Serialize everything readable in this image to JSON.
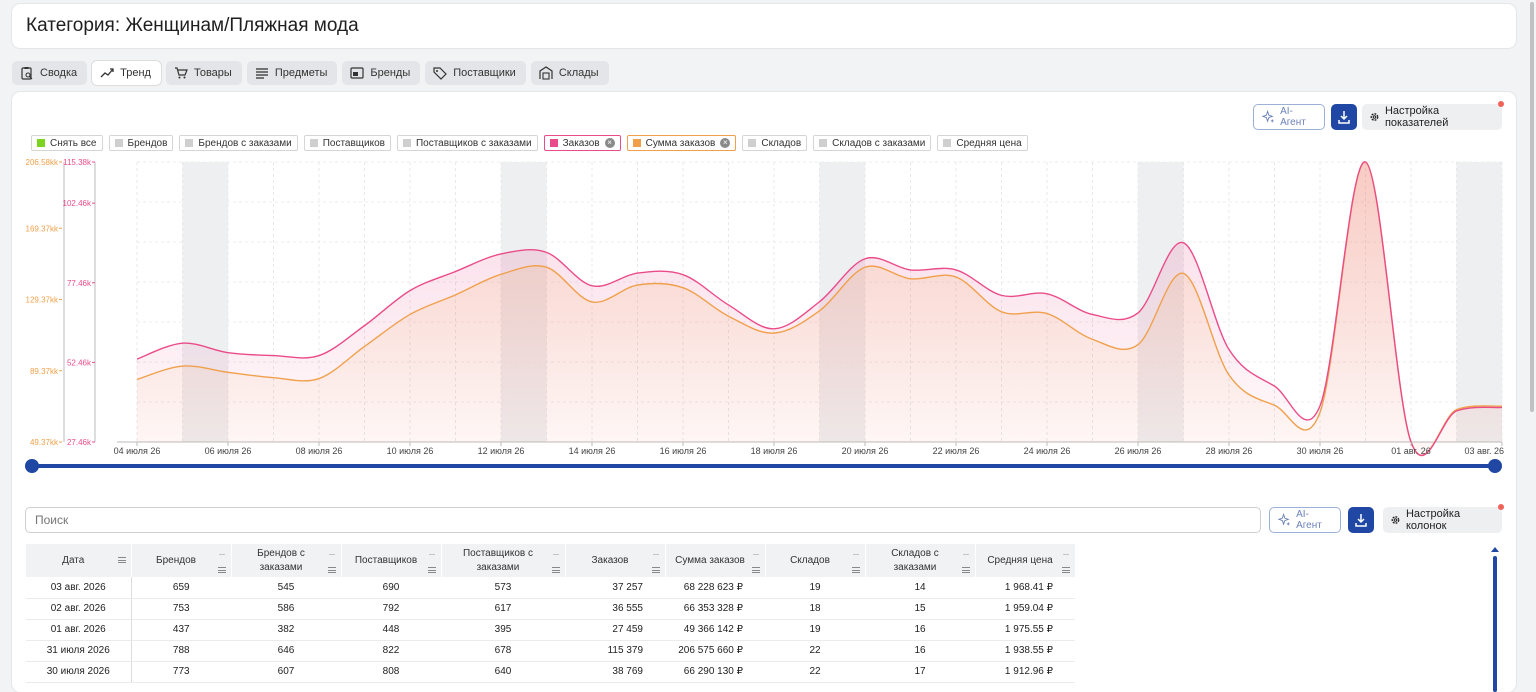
{
  "page_title": "Категория: Женщинам/Пляжная мода",
  "tabs": [
    {
      "label": "Сводка",
      "icon": "clipboard-search-icon",
      "active": false
    },
    {
      "label": "Тренд",
      "icon": "trend-icon",
      "active": true
    },
    {
      "label": "Товары",
      "icon": "cart-icon",
      "active": false
    },
    {
      "label": "Предметы",
      "icon": "list-icon",
      "active": false
    },
    {
      "label": "Бренды",
      "icon": "brand-icon",
      "active": false
    },
    {
      "label": "Поставщики",
      "icon": "tag-icon",
      "active": false
    },
    {
      "label": "Склады",
      "icon": "warehouse-icon",
      "active": false
    }
  ],
  "chart_toolbar": {
    "ai_label": "AI-Агент",
    "settings_label": "Настройка показателей"
  },
  "legend": [
    {
      "label": "Снять все",
      "color": "#7ed321",
      "removable": false
    },
    {
      "label": "Брендов",
      "color": "#cfcfcf",
      "removable": false
    },
    {
      "label": "Брендов с заказами",
      "color": "#cfcfcf",
      "removable": false
    },
    {
      "label": "Поставщиков",
      "color": "#cfcfcf",
      "removable": false
    },
    {
      "label": "Поставщиков с заказами",
      "color": "#cfcfcf",
      "removable": false
    },
    {
      "label": "Заказов",
      "color": "#ea4c89",
      "removable": true
    },
    {
      "label": "Сумма заказов",
      "color": "#f0a04b",
      "removable": true
    },
    {
      "label": "Складов",
      "color": "#cfcfcf",
      "removable": false
    },
    {
      "label": "Складов с заказами",
      "color": "#cfcfcf",
      "removable": false
    },
    {
      "label": "Средняя цена",
      "color": "#cfcfcf",
      "removable": false
    }
  ],
  "chart_data": {
    "type": "area",
    "x_tick_labels": [
      "04 июля 26",
      "06 июля 26",
      "08 июля 26",
      "10 июля 26",
      "12 июля 26",
      "14 июля 26",
      "16 июля 26",
      "18 июля 26",
      "20 июля 26",
      "22 июля 26",
      "24 июля 26",
      "26 июля 26",
      "28 июля 26",
      "30 июля 26",
      "01 авг. 26",
      "03 авг. 26"
    ],
    "x": [
      "04 июля 26",
      "05 июля 26",
      "06 июля 26",
      "07 июля 26",
      "08 июля 26",
      "09 июля 26",
      "10 июля 26",
      "11 июля 26",
      "12 июля 26",
      "13 июля 26",
      "14 июля 26",
      "15 июля 26",
      "16 июля 26",
      "17 июля 26",
      "18 июля 26",
      "19 июля 26",
      "20 июля 26",
      "21 июля 26",
      "22 июля 26",
      "23 июля 26",
      "24 июля 26",
      "25 июля 26",
      "26 июля 26",
      "27 июля 26",
      "28 июля 26",
      "29 июля 26",
      "30 июля 26",
      "31 июля 26",
      "01 авг. 26",
      "02 авг. 26",
      "03 авг. 26"
    ],
    "weekend_shading": [
      [
        1,
        2
      ],
      [
        8,
        9
      ],
      [
        15,
        16
      ],
      [
        22,
        23
      ],
      [
        29,
        30
      ]
    ],
    "y_axis_sum": {
      "ticks": [
        "49.37kk",
        "89.37kk",
        "129.37kk",
        "169.37kk",
        "206.58kk"
      ],
      "range": [
        49.37,
        206.58
      ],
      "color": "#f0a04b"
    },
    "y_axis_orders": {
      "ticks": [
        "27.46k",
        "52.46k",
        "77.46k",
        "102.46k",
        "115.38k"
      ],
      "range": [
        27.46,
        115.38
      ],
      "color": "#ea4c89"
    },
    "series": [
      {
        "name": "Заказов",
        "axis": "orders",
        "color": "#ea4c89",
        "values": [
          53.5,
          58.5,
          55.5,
          54.6,
          54.6,
          64,
          75,
          81,
          86.5,
          87,
          76.5,
          80.5,
          80,
          70.5,
          63,
          71.5,
          85,
          81.5,
          81.5,
          73.5,
          74,
          67.5,
          68,
          90,
          56.5,
          45,
          38.8,
          115.38,
          27.46,
          37.2,
          38.3
        ]
      },
      {
        "name": "Сумма заказов",
        "axis": "sum",
        "color": "#f0a04b",
        "values": [
          84.5,
          92,
          88.5,
          85.5,
          85,
          103,
          121,
          132,
          143.5,
          147.5,
          128,
          137.5,
          136,
          120,
          110.5,
          123,
          147.5,
          141,
          142,
          122.5,
          121.5,
          107,
          104,
          144,
          87,
          70,
          66,
          206.58,
          49.37,
          67.5,
          69.5
        ]
      }
    ]
  },
  "table_toolbar": {
    "search_placeholder": "Поиск",
    "ai_label": "AI-Агент",
    "settings_label": "Настройка колонок"
  },
  "table": {
    "headers": [
      "Дата",
      "Брендов",
      "Брендов с заказами",
      "Поставщиков",
      "Поставщиков с заказами",
      "Заказов",
      "Сумма заказов",
      "Складов",
      "Складов с заказами",
      "Средняя цена"
    ],
    "rows": [
      [
        "03 авг. 2026",
        "659",
        "545",
        "690",
        "573",
        "37 257",
        "68 228 623 ₽",
        "19",
        "14",
        "1 968.41 ₽"
      ],
      [
        "02 авг. 2026",
        "753",
        "586",
        "792",
        "617",
        "36 555",
        "66 353 328 ₽",
        "18",
        "15",
        "1 959.04 ₽"
      ],
      [
        "01 авг. 2026",
        "437",
        "382",
        "448",
        "395",
        "27 459",
        "49 366 142 ₽",
        "19",
        "16",
        "1 975.55 ₽"
      ],
      [
        "31 июля 2026",
        "788",
        "646",
        "822",
        "678",
        "115 379",
        "206 575 660 ₽",
        "22",
        "16",
        "1 938.55 ₽"
      ],
      [
        "30 июля 2026",
        "773",
        "607",
        "808",
        "640",
        "38 769",
        "66 290 130 ₽",
        "22",
        "17",
        "1 912.96 ₽"
      ]
    ]
  }
}
